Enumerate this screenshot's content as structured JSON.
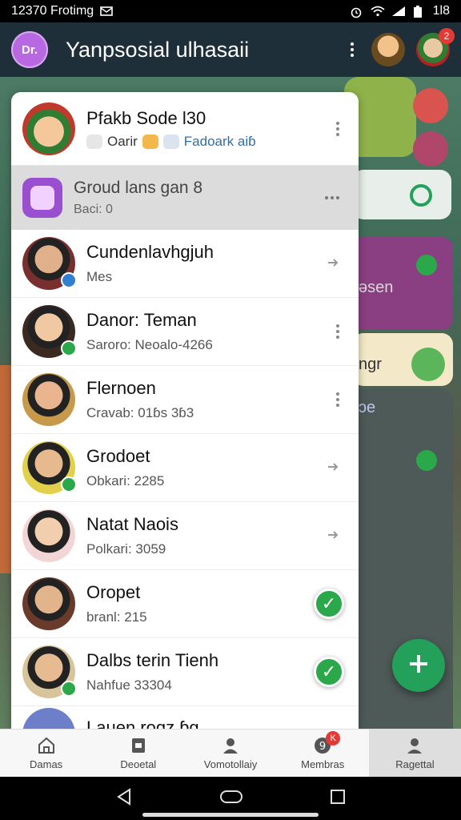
{
  "status_bar": {
    "left_text": "12370 Frotimg",
    "right_text": "1l8"
  },
  "app_bar": {
    "logo_text": "Dr.",
    "title": "Yanpsosial ulhasaii",
    "badge_count": "2"
  },
  "background": {
    "text_1": "əsen",
    "text_2": "ngr",
    "text_3": "ɔe"
  },
  "drawer": {
    "header": {
      "name": "Pfakb Sode l30",
      "sub_tag": "Oarir",
      "sub_link": "Fadoark aiɓ"
    },
    "group": {
      "name": "Groud lans gan 8",
      "sub": "Baci: 0"
    },
    "contacts": [
      {
        "name": "Cundenlavhgjuh",
        "sub": "Mes",
        "action": "arrow"
      },
      {
        "name": "Danor: Teman",
        "sub": "Saroro: Neoalo-4266",
        "action": "kebab"
      },
      {
        "name": "Flernoen",
        "sub": "Cravab: 01ɓs 3ɓ3",
        "action": "kebab"
      },
      {
        "name": "Grodoet",
        "sub": "Obkari: 2285",
        "action": "arrow"
      },
      {
        "name": "Natat Naois",
        "sub": "Polkari: 3059",
        "action": "arrow"
      },
      {
        "name": "Oropet",
        "sub": "branl: 215",
        "action": "check"
      },
      {
        "name": "Dalbs terin Tienh",
        "sub": "Nahfue 33304",
        "action": "check"
      }
    ],
    "partial_name": "Lauen roɑz ɓg"
  },
  "bottom_nav": {
    "items": [
      {
        "label": "Damas"
      },
      {
        "label": "Deoetal"
      },
      {
        "label": "Vomotollaiy"
      },
      {
        "label": "Membras",
        "badge": "K"
      },
      {
        "label": "Ragettal"
      }
    ]
  },
  "colors": {
    "app_bar": "#1f2f3a",
    "accent_green": "#2aa84a",
    "fab_green": "#23a15a",
    "badge_red": "#e53935",
    "group_purple": "#9a4fd0"
  },
  "icons": {
    "fab": "plus-icon",
    "check": "check-icon",
    "arrow": "chevron-right-icon"
  }
}
